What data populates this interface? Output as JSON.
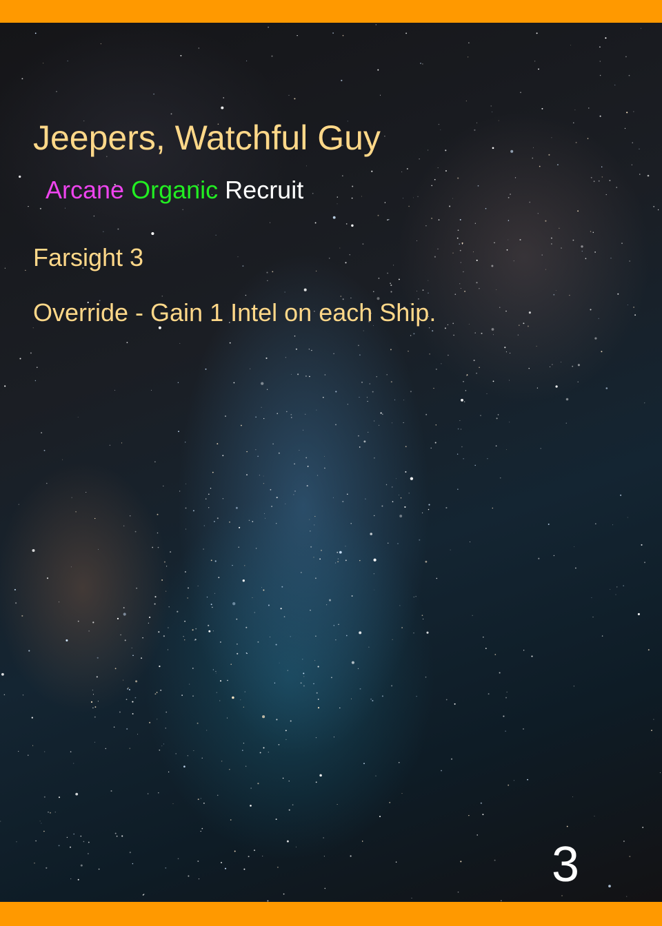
{
  "card": {
    "name": "Jeepers, Watchful Guy",
    "types": [
      {
        "label": "Arcane",
        "color": "#ee44ee"
      },
      {
        "label": "Organic",
        "color": "#22ee22"
      },
      {
        "label": "Recruit",
        "color": "#ffffff"
      }
    ],
    "keyword": "Farsight 3",
    "ability": "Override - Gain 1 Intel on each Ship.",
    "cost": "3"
  },
  "colors": {
    "border": "#ff9900",
    "text": "#ffd889",
    "cost": "#ffffff"
  }
}
